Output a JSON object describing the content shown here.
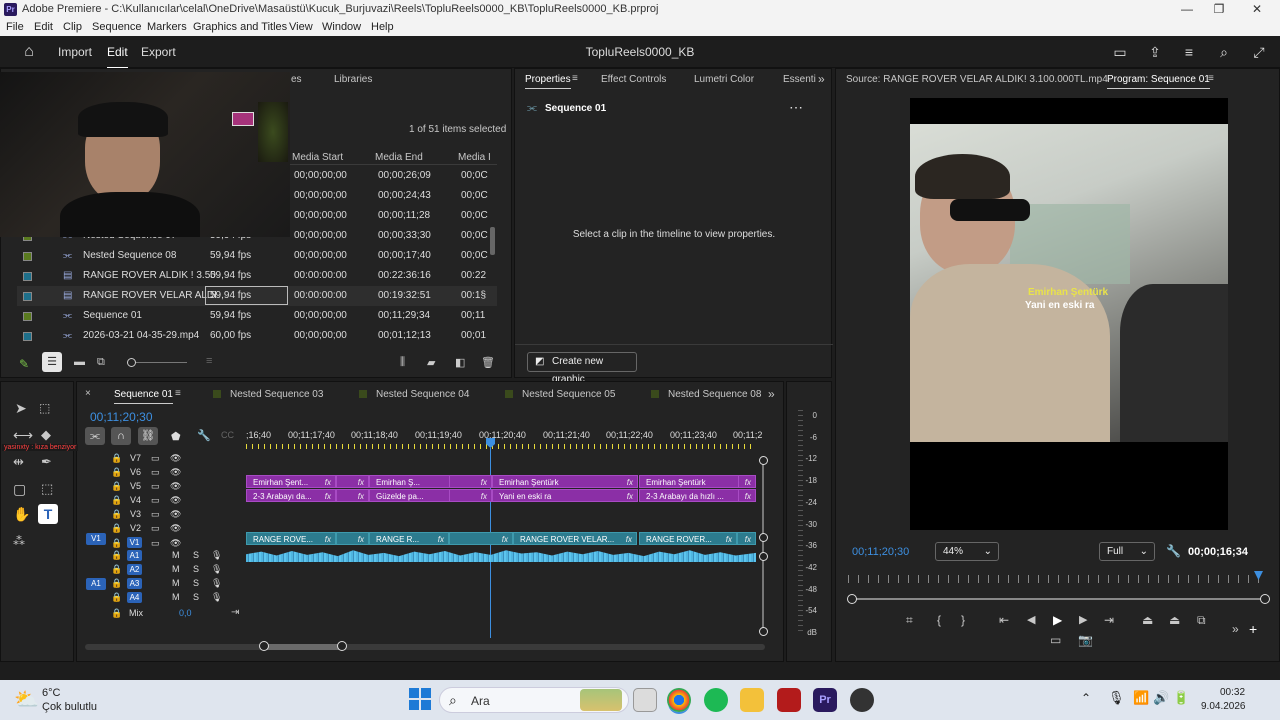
{
  "window": {
    "app_name": "Adobe Premiere",
    "title": "Adobe Premiere - C:\\Kullanıcılar\\celal\\OneDrive\\Masaüstü\\Kucuk_Burjuvazi\\Reels\\TopluReels0000_KB\\TopluReels0000_KB.prproj",
    "logo_text": "Pr"
  },
  "menu": [
    "File",
    "Edit",
    "Clip",
    "Sequence",
    "Markers",
    "Graphics and Titles",
    "View",
    "Window",
    "Help"
  ],
  "header": {
    "nav": [
      "Import",
      "Edit",
      "Export"
    ],
    "active_nav": "Edit",
    "project_name": "TopluReels0000_KB"
  },
  "project_panel": {
    "tabs": [
      "es",
      "Libraries"
    ],
    "items_status": "1 of 51 items selected",
    "columns": [
      "Media Start",
      "Media End",
      "Media I"
    ],
    "rows": [
      {
        "name": "",
        "fps": "",
        "start": "00;00;00;00",
        "end": "00;00;26;09",
        "dur": "00;0C",
        "color": "#5a7a1f"
      },
      {
        "name": "",
        "fps": "",
        "start": "00;00;00;00",
        "end": "00;00;24;43",
        "dur": "00;0C",
        "color": "#5a7a1f"
      },
      {
        "name": "",
        "fps": "",
        "start": "00;00;00;00",
        "end": "00;00;11;28",
        "dur": "00;0C",
        "color": "#5a7a1f"
      },
      {
        "name": "Nested Sequence 07",
        "fps": "59,94 fps",
        "start": "00;00;00;00",
        "end": "00;00;33;30",
        "dur": "00;0C",
        "color": "#5a7a1f"
      },
      {
        "name": "Nested Sequence 08",
        "fps": "59,94 fps",
        "start": "00;00;00;00",
        "end": "00;00;17;40",
        "dur": "00;0C",
        "color": "#5a7a1f"
      },
      {
        "name": "RANGE ROVER ALDIK ! 3.50",
        "fps": "59,94 fps",
        "start": "00:00:00:00",
        "end": "00:22:36:16",
        "dur": "00:22",
        "color": "#1e6f8a"
      },
      {
        "name": "RANGE ROVER VELAR ALDI",
        "fps": "59,94 fps",
        "start": "00:00:00:00",
        "end": "00:19:32:51",
        "dur": "00:1§",
        "color": "#1e6f8a"
      },
      {
        "name": "Sequence 01",
        "fps": "59,94 fps",
        "start": "00;00;00;00",
        "end": "00;11;29;34",
        "dur": "00;11",
        "color": "#5a7a1f"
      },
      {
        "name": "2026-03-21 04-35-29.mp4",
        "fps": "60,00 fps",
        "start": "00;00;00;00",
        "end": "00;01;12;13",
        "dur": "00;01",
        "color": "#1e6f8a"
      }
    ]
  },
  "properties_panel": {
    "tabs": [
      "Properties",
      "Effect Controls",
      "Lumetri Color",
      "Essenti"
    ],
    "sequence_name": "Sequence 01",
    "message": "Select a clip in the timeline to view properties.",
    "button": "Create new graphic"
  },
  "monitor": {
    "source_tab": "Source: RANGE ROVER VELAR ALDIK! 3.100.000TL.mp4",
    "program_tab": "Program: Sequence 01",
    "current_time": "00;11;20;30",
    "zoom": "44%",
    "quality": "Full",
    "duration": "00;00;16;34",
    "caption_name": "Emirhan Şentürk",
    "caption_text": "Yani en eski ra"
  },
  "timeline": {
    "tabs": [
      "Sequence 01",
      "Nested Sequence 03",
      "Nested Sequence 04",
      "Nested Sequence 05",
      "Nested Sequence 08"
    ],
    "timecode": "00;11;20;30",
    "ruler": [
      ";16;40",
      "00;11;17;40",
      "00;11;18;40",
      "00;11;19;40",
      "00;11;20;40",
      "00;11;21;40",
      "00;11;22;40",
      "00;11;23;40",
      "00;11;2"
    ],
    "overlay_label": "yasinxty : kıza benziyor",
    "video_tracks": [
      "V7",
      "V6",
      "V5",
      "V4",
      "V3",
      "V2",
      "V1"
    ],
    "audio_tracks": [
      "A1",
      "A2",
      "A3",
      "A4"
    ],
    "source_v": "V1",
    "source_a": "A1",
    "mix_label": "Mix",
    "mix_value": "0,0",
    "v5_clips": [
      "Emirhan Şent...",
      "Emirhan Ş...",
      "Emirhan Şentürk",
      "Emirhan Şentürk"
    ],
    "v4_clips": [
      "2-3 Arabayı da...",
      "Güzelde pa...",
      "Yani en eski ra",
      "2-3 Arabayı da hızlı ..."
    ],
    "v1_clips": [
      "RANGE ROVE...",
      "RANGE R...",
      "RANGE ROVER VELAR...",
      "RANGE ROVER..."
    ],
    "fx_label": "fx",
    "m_label": "M",
    "s_label": "S"
  },
  "vu_meter": [
    "0",
    "-6",
    "-12",
    "-18",
    "-24",
    "-30",
    "-36",
    "-42",
    "-48",
    "-54",
    "dB"
  ],
  "taskbar": {
    "weather_temp": "6°C",
    "weather_desc": "Çok bulutlu",
    "search": "Ara",
    "time": "00:32",
    "date": "9.04.2026"
  },
  "colors": {
    "accent_blue": "#3d8fe0",
    "clip_purple": "#8b2fa6",
    "clip_teal": "#2c7b8e",
    "audio_blue": "#4fb6e0"
  }
}
